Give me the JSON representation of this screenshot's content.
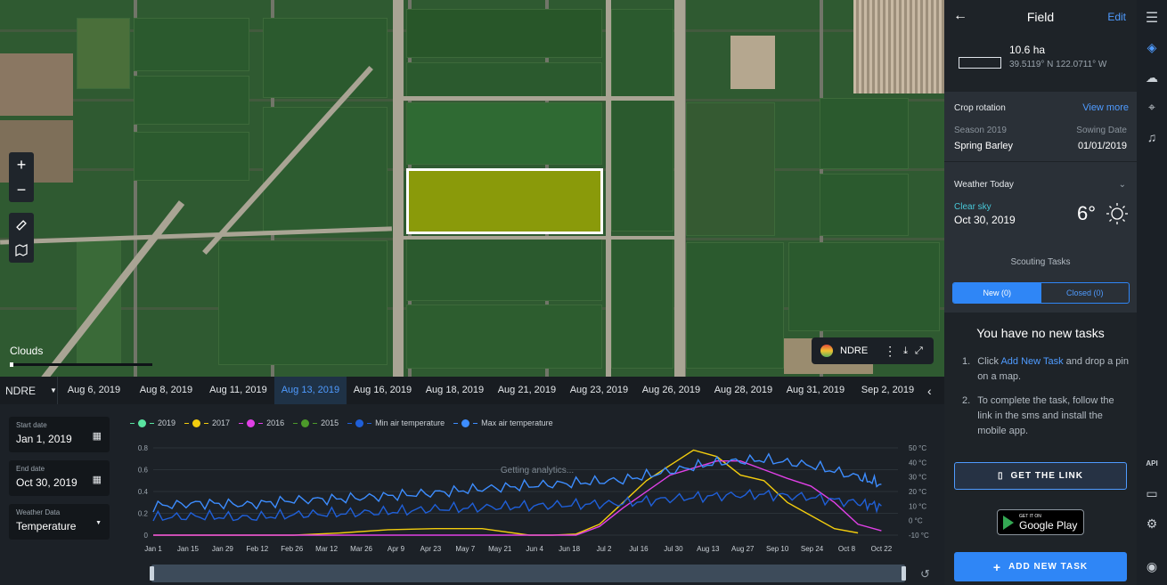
{
  "map": {
    "clouds_label": "Clouds",
    "index_pill": "NDRE"
  },
  "datebar": {
    "index": "NDRE",
    "dates": [
      "Aug 6, 2019",
      "Aug 8, 2019",
      "Aug 11, 2019",
      "Aug 13, 2019",
      "Aug 16, 2019",
      "Aug 18, 2019",
      "Aug 21, 2019",
      "Aug 23, 2019",
      "Aug 26, 2019",
      "Aug 28, 2019",
      "Aug 31, 2019",
      "Sep 2, 2019"
    ],
    "active_date": "Aug 13, 2019"
  },
  "filters": {
    "start_label": "Start date",
    "start_value": "Jan 1, 2019",
    "end_label": "End date",
    "end_value": "Oct 30, 2019",
    "weather_label": "Weather Data",
    "weather_value": "Temperature"
  },
  "chart_data": {
    "type": "line",
    "overlay_text": "Getting analytics...",
    "legend": [
      {
        "name": "2019",
        "color": "#59e3a0"
      },
      {
        "name": "2017",
        "color": "#f2cc0e"
      },
      {
        "name": "2016",
        "color": "#e040e6"
      },
      {
        "name": "2015",
        "color": "#4c9a2a"
      },
      {
        "name": "Min air temperature",
        "color": "#1f5fd8"
      },
      {
        "name": "Max air temperature",
        "color": "#3d8dff"
      }
    ],
    "x_ticks": [
      "Jan 1",
      "Jan 15",
      "Jan 29",
      "Feb 12",
      "Feb 26",
      "Mar 12",
      "Mar 26",
      "Apr 9",
      "Apr 23",
      "May 7",
      "May 21",
      "Jun 4",
      "Jun 18",
      "Jul 2",
      "Jul 16",
      "Jul 30",
      "Aug 13",
      "Aug 27",
      "Sep 10",
      "Sep 24",
      "Oct 8",
      "Oct 22"
    ],
    "y_left_ticks": [
      "0",
      "0.2",
      "0.4",
      "0.6",
      "0.8"
    ],
    "y_right_ticks": [
      "-10 °C",
      "0 °C",
      "10 °C",
      "20 °C",
      "30 °C",
      "40 °C",
      "50 °C"
    ],
    "ylim_left": [
      0,
      0.8
    ],
    "ylim_right": [
      -10,
      50
    ],
    "series": [
      {
        "name": "2017",
        "axis": "left",
        "color": "#f2cc0e",
        "x": [
          0,
          4,
          6,
          8,
          10,
          12,
          14,
          16,
          17,
          18,
          19,
          20,
          21,
          22,
          23,
          24,
          25,
          26,
          27,
          28,
          29,
          30
        ],
        "y": [
          0,
          0,
          0,
          0.02,
          0.05,
          0.06,
          0.06,
          0,
          0,
          0.01,
          0.1,
          0.3,
          0.5,
          0.64,
          0.78,
          0.72,
          0.55,
          0.5,
          0.3,
          0.18,
          0.06,
          0.02
        ]
      },
      {
        "name": "2016",
        "axis": "left",
        "color": "#e040e6",
        "x": [
          0,
          18,
          19,
          20,
          22,
          24,
          25,
          26,
          27,
          28,
          29,
          30,
          31
        ],
        "y": [
          0,
          0,
          0.08,
          0.25,
          0.55,
          0.68,
          0.68,
          0.6,
          0.52,
          0.45,
          0.3,
          0.1,
          0.04
        ]
      },
      {
        "name": "Max air temperature",
        "axis": "right",
        "color": "#3d8dff",
        "x": [
          0,
          2,
          4,
          6,
          8,
          10,
          12,
          14,
          16,
          18,
          20,
          22,
          24,
          26,
          28,
          30,
          31
        ],
        "y": [
          10,
          12,
          11,
          14,
          15,
          17,
          19,
          22,
          24,
          26,
          28,
          34,
          40,
          42,
          38,
          30,
          25
        ]
      },
      {
        "name": "Min air temperature",
        "axis": "right",
        "color": "#1f5fd8",
        "x": [
          0,
          2,
          4,
          6,
          8,
          10,
          12,
          14,
          16,
          18,
          20,
          22,
          24,
          26,
          28,
          30,
          31
        ],
        "y": [
          2,
          3,
          2,
          4,
          5,
          6,
          8,
          9,
          10,
          11,
          12,
          15,
          17,
          18,
          16,
          12,
          10
        ]
      }
    ]
  },
  "sidebar": {
    "title": "Field",
    "edit": "Edit",
    "area": "10.6 ha",
    "coords": "39.5119° N 122.0711° W",
    "crop_title": "Crop rotation",
    "view_more": "View more",
    "season_label": "Season 2019",
    "season_value": "Spring Barley",
    "sowing_label": "Sowing Date",
    "sowing_value": "01/01/2019",
    "weather_title": "Weather Today",
    "weather_cond": "Clear sky",
    "weather_date": "Oct 30, 2019",
    "weather_temp": "6°",
    "scout_title": "Scouting Tasks",
    "tab_new": "New (0)",
    "tab_closed": "Closed (0)",
    "no_tasks": "You have no new tasks",
    "step1_pre": "Click ",
    "step1_link": "Add New Task",
    "step1_post": " and drop a pin on a map.",
    "step2": "To complete the task, follow the link in the sms and install the mobile app.",
    "get_link": "GET THE LINK",
    "gplay_small": "GET IT ON",
    "gplay_big": "Google Play",
    "add_task": "ADD NEW TASK"
  },
  "rail": {
    "api": "API"
  }
}
